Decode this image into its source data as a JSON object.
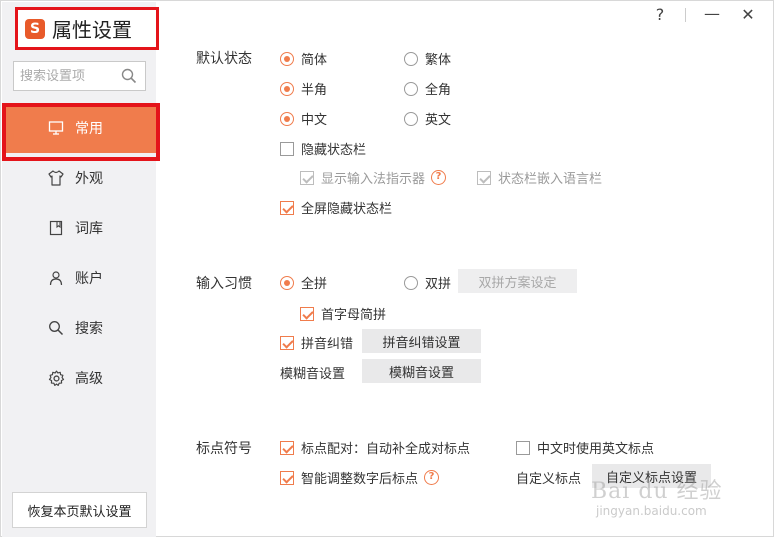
{
  "window": {
    "title": "属性设置",
    "logo_char": "S",
    "help": "?",
    "minimize": "—",
    "close": "✕"
  },
  "search": {
    "placeholder": "搜索设置项"
  },
  "sidebar": {
    "items": [
      {
        "label": "常用",
        "icon": "monitor-icon"
      },
      {
        "label": "外观",
        "icon": "shirt-icon"
      },
      {
        "label": "词库",
        "icon": "book-icon"
      },
      {
        "label": "账户",
        "icon": "user-icon"
      },
      {
        "label": "搜索",
        "icon": "search-icon"
      },
      {
        "label": "高级",
        "icon": "gear-icon"
      }
    ],
    "active": "常用",
    "reset_label": "恢复本页默认设置"
  },
  "default_state": {
    "label": "默认状态",
    "simplified": "简体",
    "traditional": "繁体",
    "half_width": "半角",
    "full_width": "全角",
    "chinese": "中文",
    "english": "英文",
    "hide_status_bar": "隐藏状态栏",
    "show_ime_indicator": "显示输入法指示器",
    "status_bar_language_bar": "状态栏嵌入语言栏",
    "fullscreen_hide_status_bar": "全屏隐藏状态栏"
  },
  "input_habits": {
    "label": "输入习惯",
    "full_pinyin": "全拼",
    "double_pinyin": "双拼",
    "double_pinyin_settings": "双拼方案设定",
    "initials_abbrev": "首字母简拼",
    "pinyin_correction": "拼音纠错",
    "pinyin_correction_settings": "拼音纠错设置",
    "fuzzy_label": "模糊音设置",
    "fuzzy_button": "模糊音设置"
  },
  "punctuation": {
    "label": "标点符号",
    "auto_pair": "标点配对：自动补全成对标点",
    "english_punct_in_chinese": "中文时使用英文标点",
    "smart_after_digits": "智能调整数字后标点",
    "custom_label": "自定义标点",
    "custom_button": "自定义标点设置"
  },
  "watermark": {
    "main": "Bai du 经验",
    "sub": "jingyan.baidu.com"
  },
  "colors": {
    "accent": "#f07c4c",
    "highlight_border": "#e4141a",
    "sidebar_bg": "#f1f1f3"
  }
}
